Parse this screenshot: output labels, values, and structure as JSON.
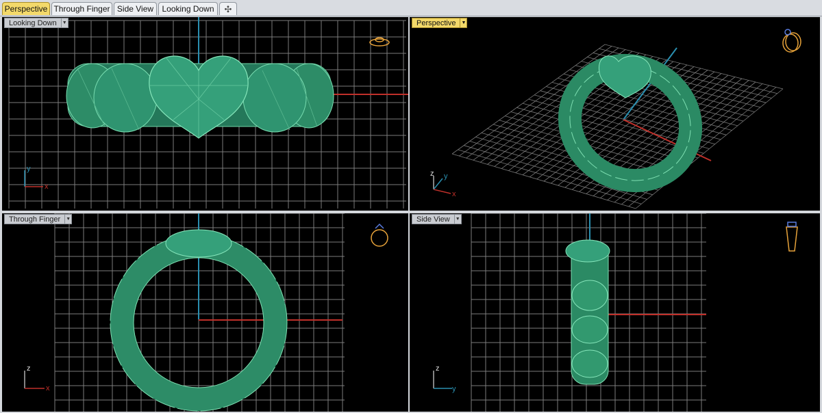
{
  "tabs": [
    {
      "label": "Perspective",
      "active": true
    },
    {
      "label": "Through Finger",
      "active": false
    },
    {
      "label": "Side View",
      "active": false
    },
    {
      "label": "Looking Down",
      "active": false
    }
  ],
  "tab_add_symbol": "✣",
  "viewports": {
    "top_left": {
      "label": "Looking Down",
      "active": false,
      "axis_labels": [
        "y",
        "x"
      ]
    },
    "top_right": {
      "label": "Perspective",
      "active": true,
      "axis_labels": [
        "z",
        "y",
        "x"
      ]
    },
    "bottom_left": {
      "label": "Through Finger",
      "active": false,
      "axis_labels": [
        "z",
        "x"
      ]
    },
    "bottom_right": {
      "label": "Side View",
      "active": false,
      "axis_labels": [
        "z",
        "y"
      ]
    }
  },
  "colors": {
    "background": "#000000",
    "grid": "#8a8a8a",
    "gem_green": "#2f8f6a",
    "x_axis": "#c0302a",
    "y_axis": "#2a8fb0",
    "active_tab": "#f3d96a",
    "orient_icon": "#e8a33a"
  },
  "dropdown_arrow": "▼"
}
